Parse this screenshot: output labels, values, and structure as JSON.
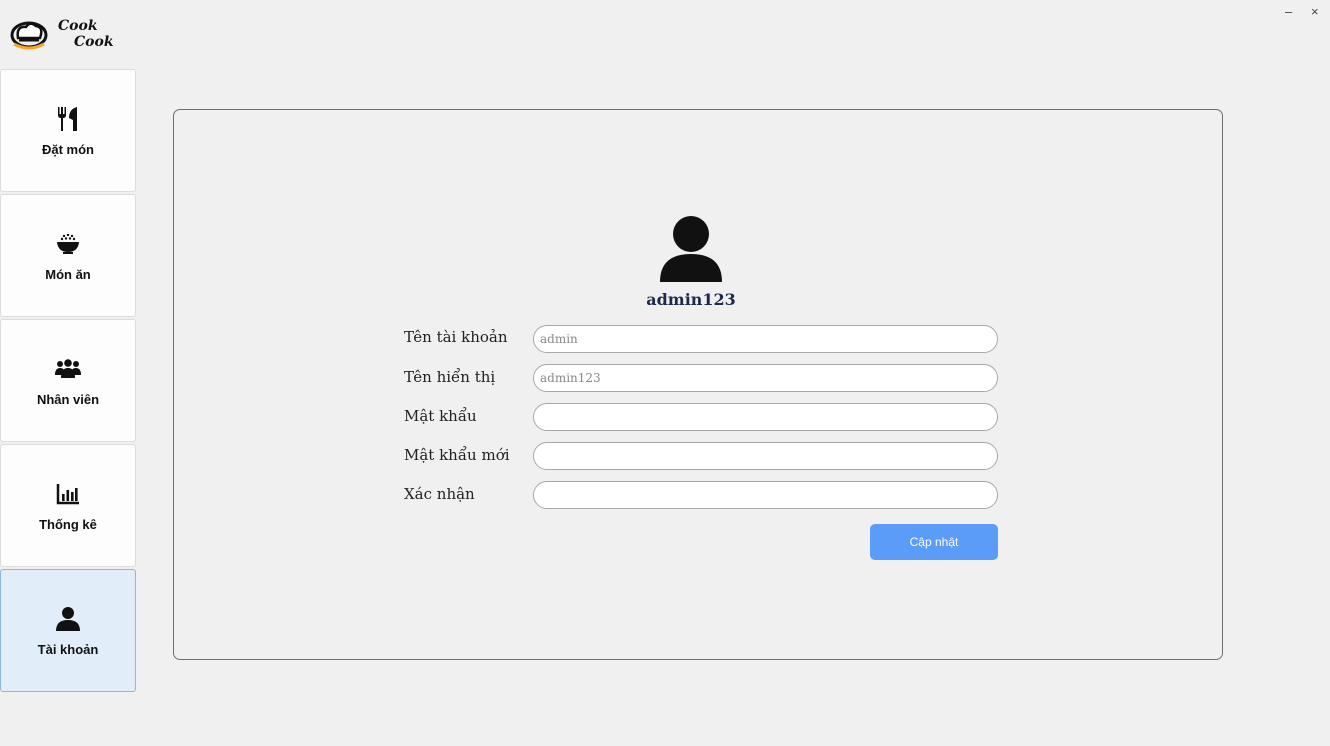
{
  "app": {
    "logo_line1": "Cook",
    "logo_line2": "Cook"
  },
  "window": {
    "minimize": "–",
    "close": "×"
  },
  "sidebar": {
    "items": [
      {
        "label": "Đặt món",
        "icon": "utensils-icon"
      },
      {
        "label": "Món ăn",
        "icon": "food-bowl-icon"
      },
      {
        "label": "Nhân viên",
        "icon": "users-icon"
      },
      {
        "label": "Thống kê",
        "icon": "bar-chart-icon"
      },
      {
        "label": "Tài khoản",
        "icon": "user-icon",
        "active": true
      }
    ]
  },
  "account": {
    "display_username": "admin123",
    "fields": [
      {
        "label": "Tên tài khoản",
        "value": "admin"
      },
      {
        "label": "Tên hiển thị",
        "value": "admin123"
      },
      {
        "label": "Mật khẩu",
        "value": ""
      },
      {
        "label": "Mật khẩu mới",
        "value": ""
      },
      {
        "label": "Xác nhận",
        "value": ""
      }
    ],
    "update_button": "Cập nhật"
  },
  "colors": {
    "background": "#f0f0f0",
    "active_nav": "#e1eefa",
    "button": "#5b9cf8",
    "username": "#1e2a4a"
  }
}
